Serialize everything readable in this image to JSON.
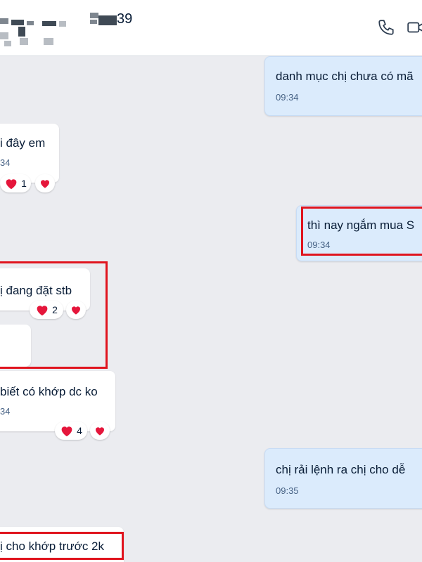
{
  "header": {
    "name_suffix": "39",
    "icons": [
      "phone-icon",
      "video-call-icon"
    ]
  },
  "colors": {
    "highlight": "#e0141e",
    "outgoing_bubble": "#dbebfc",
    "incoming_bubble": "#ffffff",
    "background": "#ebecf0"
  },
  "messages": [
    {
      "text": "danh mục chị chưa có mã",
      "time": "09:34",
      "direction": "out"
    },
    {
      "text": "i đây em",
      "time": "34",
      "direction": "in",
      "reaction_count": "1"
    },
    {
      "text": "thì nay ngắm mua S",
      "time": "09:34",
      "direction": "out"
    },
    {
      "text": "ị đang đặt stb",
      "direction": "in",
      "reaction_count": "2"
    },
    {
      "text": "",
      "direction": "in"
    },
    {
      "text": "biết có khớp dc ko",
      "time": "34",
      "direction": "in",
      "reaction_count": "4"
    },
    {
      "text": "chị rải lệnh ra chị cho dễ",
      "time": "09:35",
      "direction": "out"
    },
    {
      "text": "ị cho khớp trước 2k",
      "direction": "in"
    }
  ]
}
